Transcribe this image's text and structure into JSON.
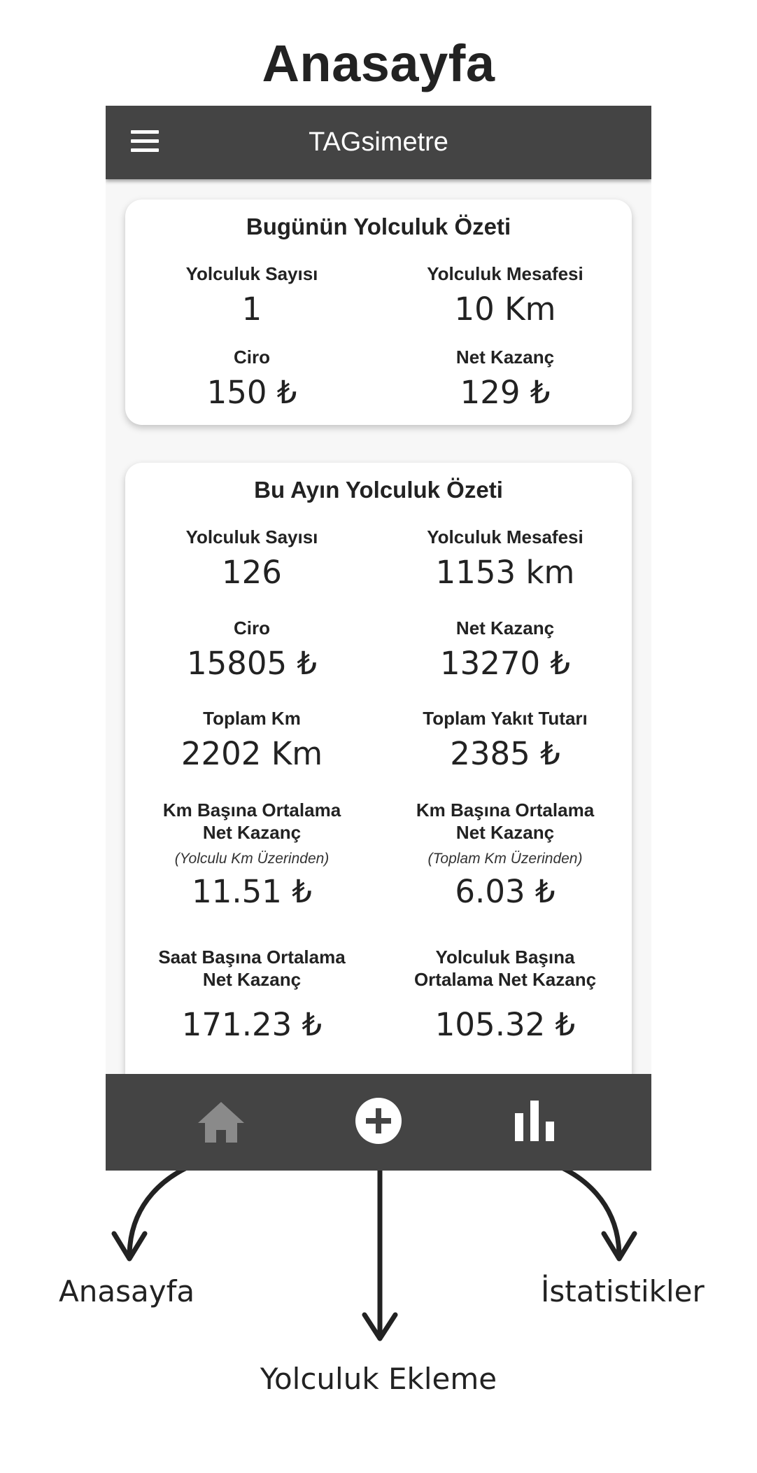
{
  "page_heading": "Anasayfa",
  "app": {
    "title": "TAGsimetre",
    "menu_icon": "hamburger-menu-icon"
  },
  "today_card": {
    "title": "Bugünün Yolculuk Özeti",
    "stats": [
      {
        "label": "Yolculuk Sayısı",
        "value": "1"
      },
      {
        "label": "Yolculuk Mesafesi",
        "value": "10 Km"
      },
      {
        "label": "Ciro",
        "value": "150 ₺"
      },
      {
        "label": "Net Kazanç",
        "value": "129 ₺"
      }
    ]
  },
  "month_card": {
    "title": "Bu Ayın Yolculuk Özeti",
    "stats": [
      {
        "label": "Yolculuk Sayısı",
        "value": "126"
      },
      {
        "label": "Yolculuk Mesafesi",
        "value": "1153 km"
      },
      {
        "label": "Ciro",
        "value": "15805 ₺"
      },
      {
        "label": "Net Kazanç",
        "value": "13270 ₺"
      },
      {
        "label": "Toplam Km",
        "value": "2202 Km"
      },
      {
        "label": "Toplam Yakıt Tutarı",
        "value": "2385 ₺"
      },
      {
        "label_line1": "Km Başına Ortalama",
        "label_line2": "Net Kazanç",
        "note": "(Yolculu Km Üzerinden)",
        "value": "11.51 ₺"
      },
      {
        "label_line1": "Km Başına Ortalama",
        "label_line2": "Net Kazanç",
        "note": "(Toplam Km Üzerinden)",
        "value": "6.03 ₺"
      },
      {
        "label_line1": "Saat Başına Ortalama",
        "label_line2": "Net Kazanç",
        "value": "171.23 ₺"
      },
      {
        "label_line1": "Yolculuk Başına",
        "label_line2": "Ortalama Net Kazanç",
        "value": "105.32 ₺"
      }
    ]
  },
  "bottom_nav": {
    "items": [
      {
        "icon": "home-icon",
        "active": true
      },
      {
        "icon": "add-circle-icon",
        "active": false
      },
      {
        "icon": "bar-chart-icon",
        "active": false
      }
    ]
  },
  "callouts": {
    "home": "Anasayfa",
    "add": "Yolculuk Ekleme",
    "stats": "İstatistikler"
  },
  "colors": {
    "app_bar": "#444444",
    "card": "#ffffff",
    "background": "#f7f7f7",
    "nav_active_icon": "#8a8a8a",
    "nav_icon": "#ffffff"
  }
}
